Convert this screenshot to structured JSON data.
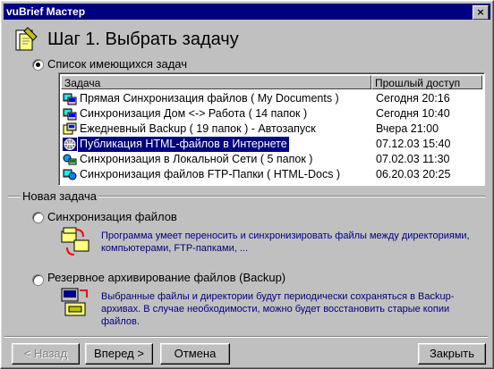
{
  "window": {
    "title": "vuBrief Мастер",
    "close_glyph": "×"
  },
  "step": {
    "title": "Шаг 1. Выбрать задачу"
  },
  "existing": {
    "label": "Список имеющихся задач",
    "columns": [
      "Задача",
      "Прошлый доступ"
    ],
    "tasks": [
      {
        "name": "Прямая Синхронизация файлов ( My Documents )",
        "last": "Сегодня  20:16",
        "icon": "sync-icon"
      },
      {
        "name": "Синхронизация Дом <-> Работа ( 14 папок )",
        "last": "Сегодня  10:40",
        "icon": "sync-icon"
      },
      {
        "name": "Ежедневный Backup ( 19 папок ) - Автозапуск",
        "last": "Вчера  21:00",
        "icon": "backup-icon"
      },
      {
        "name": "Публикация HTML-файлов в Интернете",
        "last": "07.12.03  15:40",
        "icon": "globe-icon",
        "selected": true
      },
      {
        "name": "Синхронизация в Локальной Сети ( 5 папок )",
        "last": "07.02.03  11:30",
        "icon": "network-icon"
      },
      {
        "name": "Синхронизация файлов FTP-Папки ( HTML-Docs )",
        "last": "06.20.03  20:25",
        "icon": "ftp-icon"
      }
    ]
  },
  "new_task": {
    "group_title": "Новая задача",
    "sync": {
      "label": "Синхронизация файлов",
      "desc": "Программа умеет переносить и синхронизировать файлы между директориями, компьютерами, FTP-папками, ..."
    },
    "backup": {
      "label": "Резервное архивирование файлов (Backup)",
      "desc": "Выбранные файлы и директории будут периодически сохраняться в Backup-архивах. В случае необходимости, можно будет восстановить старые копии файлов."
    }
  },
  "buttons": {
    "back": "< Назад",
    "next": "Вперед >",
    "cancel": "Отмена",
    "close": "Закрыть"
  },
  "colors": {
    "titlebar": "#000080",
    "face": "#c0c0c0",
    "desc_text": "#000080",
    "selection": "#000080"
  }
}
